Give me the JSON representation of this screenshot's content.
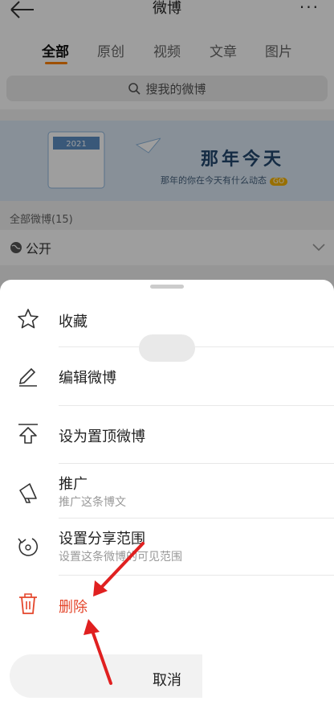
{
  "topbar": {
    "title": "微博",
    "more": "···"
  },
  "tabs": [
    {
      "label": "全部",
      "active": true
    },
    {
      "label": "原创"
    },
    {
      "label": "视频"
    },
    {
      "label": "文章"
    },
    {
      "label": "图片"
    }
  ],
  "search": {
    "placeholder": "搜我的微博"
  },
  "banner": {
    "title": "那年今天",
    "subtitle": "那年的你在今天有什么动态",
    "go": "GO",
    "calendar_year": "2021"
  },
  "list": {
    "count_label": "全部微博(15)",
    "scope_label": "公开"
  },
  "sheet": {
    "items": [
      {
        "label": "收藏",
        "icon": "star-icon"
      },
      {
        "label": "编辑微博",
        "icon": "pencil-icon"
      },
      {
        "label": "设为置顶微博",
        "icon": "pin-top-icon"
      },
      {
        "label": "推广",
        "sub": "推广这条博文",
        "icon": "megaphone-icon"
      },
      {
        "label": "设置分享范围",
        "sub": "设置这条微博的可见范围",
        "icon": "share-scope-icon"
      },
      {
        "label": "删除",
        "icon": "trash-icon",
        "color": "#e4462b"
      }
    ],
    "cancel_label": "取消"
  },
  "colors": {
    "accent": "#ff8200",
    "danger": "#e4462b",
    "annotation_arrow": "#e02020"
  }
}
